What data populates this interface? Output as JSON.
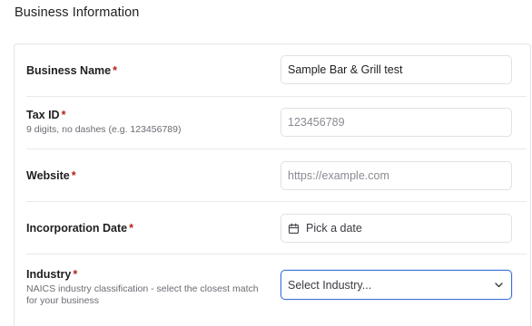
{
  "section": {
    "title": "Business Information"
  },
  "fields": {
    "business_name": {
      "label": "Business Name",
      "required_mark": "*",
      "value": "Sample Bar & Grill test"
    },
    "tax_id": {
      "label": "Tax ID",
      "required_mark": "*",
      "hint": "9 digits, no dashes (e.g. 123456789)",
      "placeholder": "123456789"
    },
    "website": {
      "label": "Website",
      "required_mark": "*",
      "placeholder": "https://example.com"
    },
    "incorporation_date": {
      "label": "Incorporation Date",
      "required_mark": "*",
      "placeholder": "Pick a date",
      "icon": "calendar-icon"
    },
    "industry": {
      "label": "Industry",
      "required_mark": "*",
      "hint": "NAICS industry classification - select the closest match for your business",
      "selected": "Select Industry...",
      "icon": "chevron-down-icon"
    }
  },
  "colors": {
    "required": "#b42318",
    "focus_border": "#3b6fd8"
  }
}
